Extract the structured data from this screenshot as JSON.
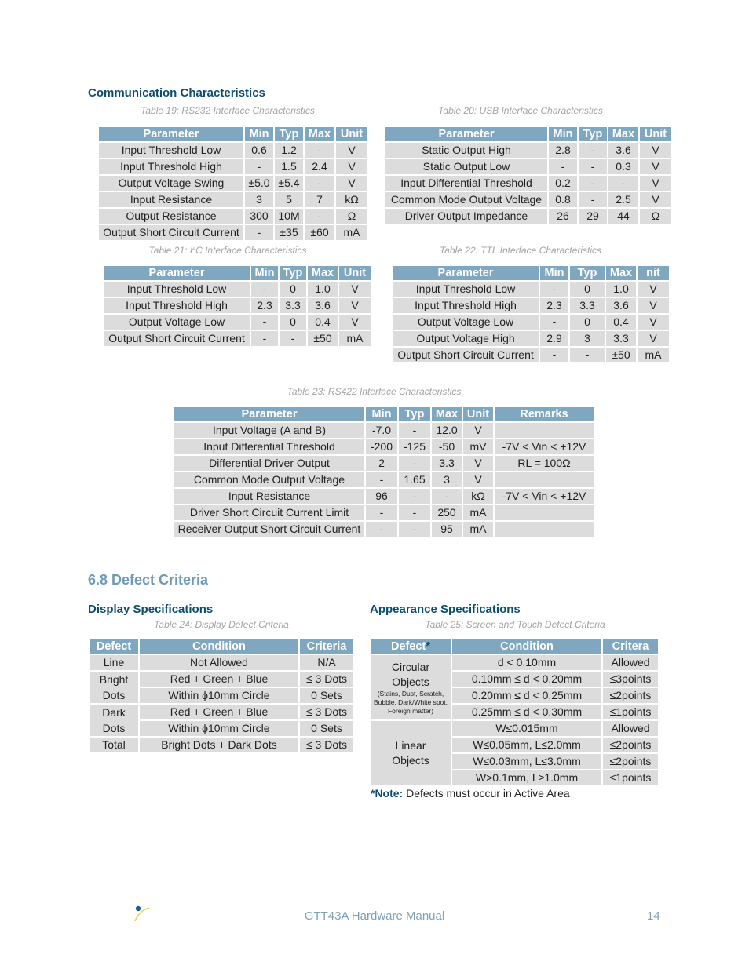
{
  "section_comm": "Communication Characteristics",
  "section_defect": "6.8 Defect Criteria",
  "sub_display": "Display Specifications",
  "sub_appearance": "Appearance Specifications",
  "tables": {
    "t19": {
      "caption": "Table 19: RS232 Interface Characteristics",
      "headers": [
        "Parameter",
        "Min",
        "Typ",
        "Max",
        "Unit"
      ],
      "rows": [
        [
          "Input Threshold Low",
          "0.6",
          "1.2",
          "-",
          "V"
        ],
        [
          "Input Threshold High",
          "-",
          "1.5",
          "2.4",
          "V"
        ],
        [
          "Output Voltage Swing",
          "±5.0",
          "±5.4",
          "-",
          "V"
        ],
        [
          "Input Resistance",
          "3",
          "5",
          "7",
          "kΩ"
        ],
        [
          "Output Resistance",
          "300",
          "10M",
          "-",
          "Ω"
        ],
        [
          "Output Short Circuit Current",
          "-",
          "±35",
          "±60",
          "mA"
        ]
      ]
    },
    "t20": {
      "caption": "Table 20: USB Interface Characteristics",
      "headers": [
        "Parameter",
        "Min",
        "Typ",
        "Max",
        "Unit"
      ],
      "rows": [
        [
          "Static Output High",
          "2.8",
          "-",
          "3.6",
          "V"
        ],
        [
          "Static Output Low",
          "-",
          "-",
          "0.3",
          "V"
        ],
        [
          "Input Differential Threshold",
          "0.2",
          "-",
          "-",
          "V"
        ],
        [
          "Common Mode Output Voltage",
          "0.8",
          "-",
          "2.5",
          "V"
        ],
        [
          "Driver Output Impedance",
          "26",
          "29",
          "44",
          "Ω"
        ]
      ]
    },
    "t21": {
      "caption_pre": "Table 21: I",
      "caption_sup": "2",
      "caption_post": "C Interface Characteristics",
      "headers": [
        "Parameter",
        "Min",
        "Typ",
        "Max",
        "Unit"
      ],
      "rows": [
        [
          "Input Threshold Low",
          "-",
          "0",
          "1.0",
          "V"
        ],
        [
          "Input Threshold High",
          "2.3",
          "3.3",
          "3.6",
          "V"
        ],
        [
          "Output Voltage Low",
          "-",
          "0",
          "0.4",
          "V"
        ],
        [
          "Output Short Circuit Current",
          "-",
          "-",
          "±50",
          "mA"
        ]
      ]
    },
    "t22": {
      "caption": "Table 22: TTL Interface Characteristics",
      "headers": [
        "Parameter",
        "Min",
        "Typ",
        "Max",
        "nit"
      ],
      "rows": [
        [
          "Input Threshold Low",
          "-",
          "0",
          "1.0",
          "V"
        ],
        [
          "Input Threshold High",
          "2.3",
          "3.3",
          "3.6",
          "V"
        ],
        [
          "Output Voltage Low",
          "-",
          "0",
          "0.4",
          "V"
        ],
        [
          "Output Voltage High",
          "2.9",
          "3",
          "3.3",
          "V"
        ],
        [
          "Output Short Circuit Current",
          "-",
          "-",
          "±50",
          "mA"
        ]
      ]
    },
    "t23": {
      "caption": "Table 23: RS422 Interface Characteristics",
      "headers": [
        "Parameter",
        "Min",
        "Typ",
        "Max",
        "Unit",
        "Remarks"
      ],
      "rows": [
        [
          "Input Voltage (A and B)",
          "-7.0",
          "-",
          "12.0",
          "V",
          ""
        ],
        [
          "Input Differential Threshold",
          "-200",
          "-125",
          "-50",
          "mV",
          "-7V < Vin < +12V"
        ],
        [
          "Differential Driver Output",
          "2",
          "-",
          "3.3",
          "V",
          "RL = 100Ω"
        ],
        [
          "Common Mode Output Voltage",
          "-",
          "1.65",
          "3",
          "V",
          ""
        ],
        [
          "Input Resistance",
          "96",
          "-",
          "-",
          "kΩ",
          "-7V < Vin < +12V"
        ],
        [
          "Driver Short Circuit Current Limit",
          "-",
          "-",
          "250",
          "mA",
          ""
        ],
        [
          "Receiver Output Short Circuit Current",
          "-",
          "-",
          "95",
          "mA",
          ""
        ]
      ]
    },
    "t24": {
      "caption": "Table 24: Display Defect Criteria",
      "headers": [
        "Defect",
        "Condition",
        "Criteria"
      ],
      "line": {
        "defect": "Line",
        "condition": "Not Allowed",
        "criteria": "N/A"
      },
      "bright": {
        "defect_1": "Bright",
        "defect_2": "Dots",
        "cond_1": "Red + Green + Blue",
        "crit_1": "≤ 3 Dots",
        "cond_2": "Within ϕ10mm Circle",
        "crit_2": "0 Sets"
      },
      "dark": {
        "defect_1": "Dark",
        "defect_2": "Dots",
        "cond_1": "Red + Green + Blue",
        "crit_1": "≤ 3 Dots",
        "cond_2": "Within ϕ10mm Circle",
        "crit_2": "0 Sets"
      },
      "total": {
        "defect": "Total",
        "condition": "Bright Dots + Dark Dots",
        "criteria": "≤ 3 Dots"
      }
    },
    "t25": {
      "caption": "Table 25: Screen and Touch Defect Criteria",
      "headers": {
        "defect": "Defect",
        "defect_star": "*",
        "condition": "Condition",
        "criteria": "Critera"
      },
      "circular": {
        "label_1": "Circular",
        "label_2": "Objects",
        "detail": "(Stains, Dust, Scratch, Bubble, Dark/White spot, Foreign matter)",
        "rows": [
          [
            "d < 0.10mm",
            "Allowed"
          ],
          [
            "0.10mm ≤ d < 0.20mm",
            "≤3points"
          ],
          [
            "0.20mm ≤ d < 0.25mm",
            "≤2points"
          ],
          [
            "0.25mm ≤ d < 0.30mm",
            "≤1points"
          ]
        ]
      },
      "linear": {
        "label_1": "Linear",
        "label_2": "Objects",
        "rows": [
          [
            "W≤0.015mm",
            "Allowed"
          ],
          [
            "W≤0.05mm, L≤2.0mm",
            "≤2points"
          ],
          [
            "W≤0.03mm, L≤3.0mm",
            "≤2points"
          ],
          [
            "W>0.1mm, L≥1.0mm",
            "≤1points"
          ]
        ]
      },
      "note_label": "*Note:",
      "note_text": " Defects must occur in Active Area"
    }
  },
  "footer": {
    "logo_icon": "matrix-orbital-logo",
    "title": "GTT43A Hardware Manual",
    "page": "14"
  }
}
